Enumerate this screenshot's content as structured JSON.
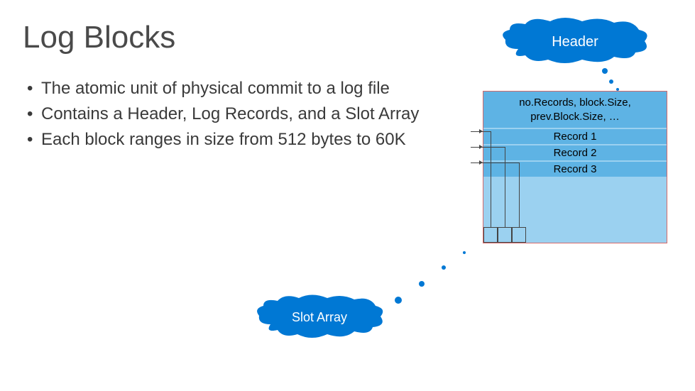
{
  "title": "Log Blocks",
  "bullets": [
    "The atomic unit of physical commit to a log file",
    "Contains a Header, Log Records, and a Slot Array",
    "Each block ranges in size from 512 bytes to 60K"
  ],
  "callouts": {
    "header": "Header",
    "slot_array": "Slot Array"
  },
  "block": {
    "header_line1": "no.Records, block.Size,",
    "header_line2": "prev.Block.Size, …",
    "records": [
      "Record 1",
      "Record 2",
      "Record 3"
    ],
    "slot_count": 3
  },
  "colors": {
    "accent": "#0078d4",
    "block_fill": "#9bd1f0",
    "block_band": "#5eb3e4",
    "block_border": "#d46a6a"
  }
}
